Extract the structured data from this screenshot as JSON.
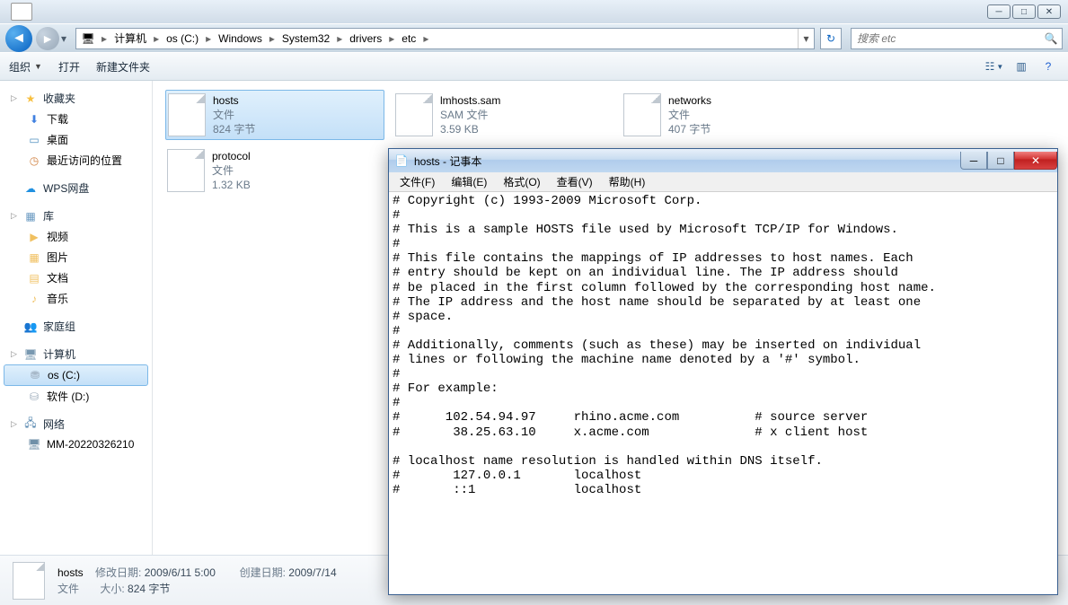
{
  "explorer": {
    "breadcrumb": [
      "计算机",
      "os (C:)",
      "Windows",
      "System32",
      "drivers",
      "etc"
    ],
    "search_placeholder": "搜索 etc",
    "toolbar": {
      "organize": "组织",
      "open": "打开",
      "new_folder": "新建文件夹"
    },
    "sidebar": {
      "favorites": {
        "label": "收藏夹",
        "items": [
          "下载",
          "桌面",
          "最近访问的位置"
        ]
      },
      "wps": {
        "label": "WPS网盘"
      },
      "libraries": {
        "label": "库",
        "items": [
          "视频",
          "图片",
          "文档",
          "音乐"
        ]
      },
      "homegroup": {
        "label": "家庭组"
      },
      "computer": {
        "label": "计算机",
        "items": [
          "os (C:)",
          "软件 (D:)"
        ]
      },
      "network": {
        "label": "网络",
        "items": [
          "MM-20220326210"
        ]
      }
    },
    "files": [
      {
        "name": "hosts",
        "type": "文件",
        "size": "824 字节",
        "sel": true
      },
      {
        "name": "lmhosts.sam",
        "type": "SAM 文件",
        "size": "3.59 KB",
        "sel": false
      },
      {
        "name": "networks",
        "type": "文件",
        "size": "407 字节",
        "sel": false
      },
      {
        "name": "protocol",
        "type": "文件",
        "size": "1.32 KB",
        "sel": false
      }
    ],
    "details": {
      "name": "hosts",
      "modified_label": "修改日期:",
      "modified": "2009/6/11 5:00",
      "created_label": "创建日期:",
      "created": "2009/7/14",
      "type": "文件",
      "size_label": "大小:",
      "size": "824 字节"
    }
  },
  "notepad": {
    "title": "hosts - 记事本",
    "menu": [
      "文件(F)",
      "编辑(E)",
      "格式(O)",
      "查看(V)",
      "帮助(H)"
    ],
    "content": "# Copyright (c) 1993-2009 Microsoft Corp.\n#\n# This is a sample HOSTS file used by Microsoft TCP/IP for Windows.\n#\n# This file contains the mappings of IP addresses to host names. Each\n# entry should be kept on an individual line. The IP address should\n# be placed in the first column followed by the corresponding host name.\n# The IP address and the host name should be separated by at least one\n# space.\n#\n# Additionally, comments (such as these) may be inserted on individual\n# lines or following the machine name denoted by a '#' symbol.\n#\n# For example:\n#\n#      102.54.94.97     rhino.acme.com          # source server\n#       38.25.63.10     x.acme.com              # x client host\n\n# localhost name resolution is handled within DNS itself.\n#\t127.0.0.1       localhost\n#\t::1             localhost"
  }
}
